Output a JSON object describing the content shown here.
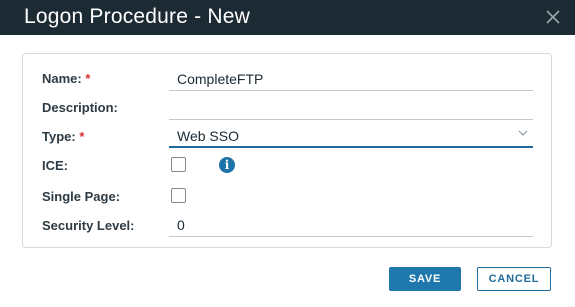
{
  "dialog": {
    "title": "Logon Procedure - New",
    "close_icon": "close-icon"
  },
  "form": {
    "name": {
      "label": "Name:",
      "required_mark": "*",
      "value": "CompleteFTP"
    },
    "description": {
      "label": "Description:",
      "value": ""
    },
    "type": {
      "label": "Type:",
      "required_mark": "*",
      "value": "Web SSO",
      "icon": "chevron-down-icon"
    },
    "ice": {
      "label": "ICE:",
      "checked": false,
      "info_icon": "info-icon",
      "info_glyph": "i"
    },
    "single_page": {
      "label": "Single Page:",
      "checked": false
    },
    "security_level": {
      "label": "Security Level:",
      "value": "0"
    }
  },
  "buttons": {
    "save_label": "SAVE",
    "cancel_label": "CANCEL"
  },
  "colors": {
    "titlebar": "#1c2a33",
    "accent": "#1f78ad",
    "required": "#d0312d"
  }
}
